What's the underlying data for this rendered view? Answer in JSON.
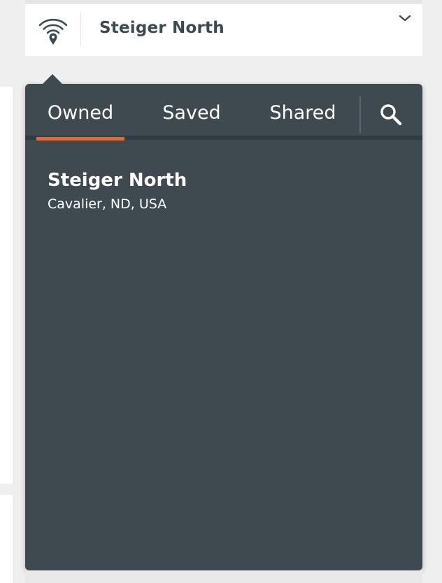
{
  "header": {
    "title": "Steiger North",
    "location_icon": "wifi-location-pin-icon",
    "expand_icon": "chevron-down-icon"
  },
  "dropdown": {
    "tabs": [
      {
        "label": "Owned",
        "active": true
      },
      {
        "label": "Saved",
        "active": false
      },
      {
        "label": "Shared",
        "active": false
      }
    ],
    "search_icon": "search-icon",
    "items": [
      {
        "title": "Steiger North",
        "subtitle": "Cavalier, ND, USA"
      }
    ]
  },
  "colors": {
    "dropdown_bg": "#3e4950",
    "active_tab_underline": "#e9692f",
    "header_text": "#3c4a52"
  }
}
